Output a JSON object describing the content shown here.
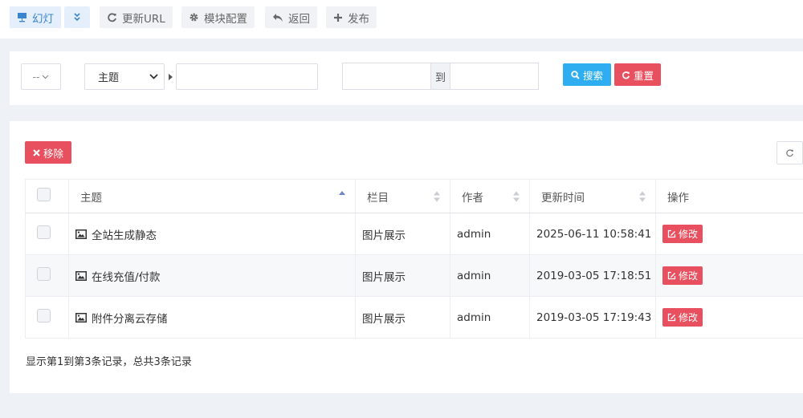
{
  "toolbar": {
    "slideshow_label": "幻灯",
    "update_url_label": "更新URL",
    "module_config_label": "模块配置",
    "back_label": "返回",
    "publish_label": "发布"
  },
  "search": {
    "small_select_value": "--",
    "field_select_value": "主题",
    "date_to_label": "到",
    "search_button_label": "搜索",
    "reset_button_label": "重置"
  },
  "actions": {
    "remove_button_label": "移除"
  },
  "table": {
    "headers": {
      "subject": "主题",
      "category": "栏目",
      "author": "作者",
      "updated": "更新时间",
      "operation": "操作"
    },
    "edit_label": "修改",
    "rows": [
      {
        "subject": "全站生成静态",
        "category": "图片展示",
        "author": "admin",
        "updated": "2025-06-11 10:58:41"
      },
      {
        "subject": "在线充值/付款",
        "category": "图片展示",
        "author": "admin",
        "updated": "2019-03-05 17:18:51"
      },
      {
        "subject": "附件分离云存储",
        "category": "图片展示",
        "author": "admin",
        "updated": "2019-03-05 17:19:43"
      }
    ]
  },
  "pagination": {
    "info": "显示第1到第3条记录，总共3条记录"
  },
  "colors": {
    "accent_blue": "#2eaef0",
    "danger_red": "#e8505f",
    "highlight_time_red": "#e0282f"
  },
  "icons": {
    "slideshow": "slideshow-icon",
    "collapse": "double-chevron-down-icon",
    "update_url": "refresh-icon",
    "module_config": "gear-icon",
    "back": "reply-icon",
    "publish": "plus-icon",
    "search": "search-icon",
    "reset": "refresh-icon",
    "remove": "x-icon",
    "refresh_table": "refresh-icon",
    "row_image": "image-icon",
    "edit": "edit-icon"
  }
}
